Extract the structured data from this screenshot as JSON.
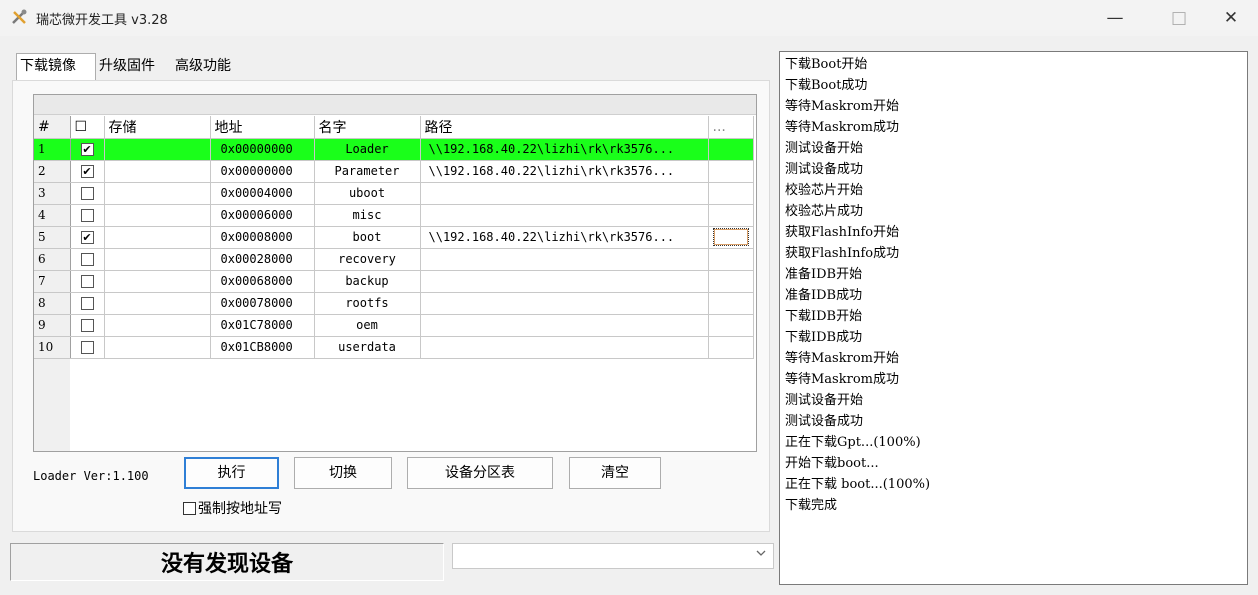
{
  "window": {
    "title": "瑞芯微开发工具 v3.28",
    "minimize": "—",
    "maximize": "□",
    "close": "✕"
  },
  "tabs": [
    {
      "label": "下载镜像",
      "active": true
    },
    {
      "label": "升级固件",
      "active": false
    },
    {
      "label": "高级功能",
      "active": false
    }
  ],
  "table": {
    "headers": {
      "num": "#",
      "check": "☐",
      "storage": "存储",
      "address": "地址",
      "name": "名字",
      "path": "路径",
      "more": "..."
    },
    "rows": [
      {
        "num": "1",
        "checked": "✔",
        "storage": "",
        "address": "0x00000000",
        "name": "Loader",
        "path": "\\\\192.168.40.22\\lizhi\\rk\\rk3576..."
      },
      {
        "num": "2",
        "checked": "✔",
        "storage": "",
        "address": "0x00000000",
        "name": "Parameter",
        "path": "\\\\192.168.40.22\\lizhi\\rk\\rk3576..."
      },
      {
        "num": "3",
        "checked": "",
        "storage": "",
        "address": "0x00004000",
        "name": "uboot",
        "path": ""
      },
      {
        "num": "4",
        "checked": "",
        "storage": "",
        "address": "0x00006000",
        "name": "misc",
        "path": ""
      },
      {
        "num": "5",
        "checked": "✔",
        "storage": "",
        "address": "0x00008000",
        "name": "boot",
        "path": "\\\\192.168.40.22\\lizhi\\rk\\rk3576..."
      },
      {
        "num": "6",
        "checked": "",
        "storage": "",
        "address": "0x00028000",
        "name": "recovery",
        "path": ""
      },
      {
        "num": "7",
        "checked": "",
        "storage": "",
        "address": "0x00068000",
        "name": "backup",
        "path": ""
      },
      {
        "num": "8",
        "checked": "",
        "storage": "",
        "address": "0x00078000",
        "name": "rootfs",
        "path": ""
      },
      {
        "num": "9",
        "checked": "",
        "storage": "",
        "address": "0x01C78000",
        "name": "oem",
        "path": ""
      },
      {
        "num": "10",
        "checked": "",
        "storage": "",
        "address": "0x01CB8000",
        "name": "userdata",
        "path": ""
      }
    ],
    "highlight_color": "#1aff1a"
  },
  "controls": {
    "loader_ver": "Loader Ver:1.100",
    "execute": "执行",
    "switch": "切换",
    "partition_table": "设备分区表",
    "clear": "清空",
    "force_address": "强制按地址写"
  },
  "status": {
    "message": "没有发现设备",
    "device_select": ""
  },
  "log": [
    "下载Boot开始",
    "下载Boot成功",
    "等待Maskrom开始",
    "等待Maskrom成功",
    "测试设备开始",
    "测试设备成功",
    "校验芯片开始",
    "校验芯片成功",
    "获取FlashInfo开始",
    "获取FlashInfo成功",
    "准备IDB开始",
    "准备IDB成功",
    "下载IDB开始",
    "下载IDB成功",
    "等待Maskrom开始",
    "等待Maskrom成功",
    "测试设备开始",
    "测试设备成功",
    "正在下载Gpt...(100%)",
    "开始下载boot...",
    "正在下载 boot...(100%)",
    "下载完成"
  ]
}
